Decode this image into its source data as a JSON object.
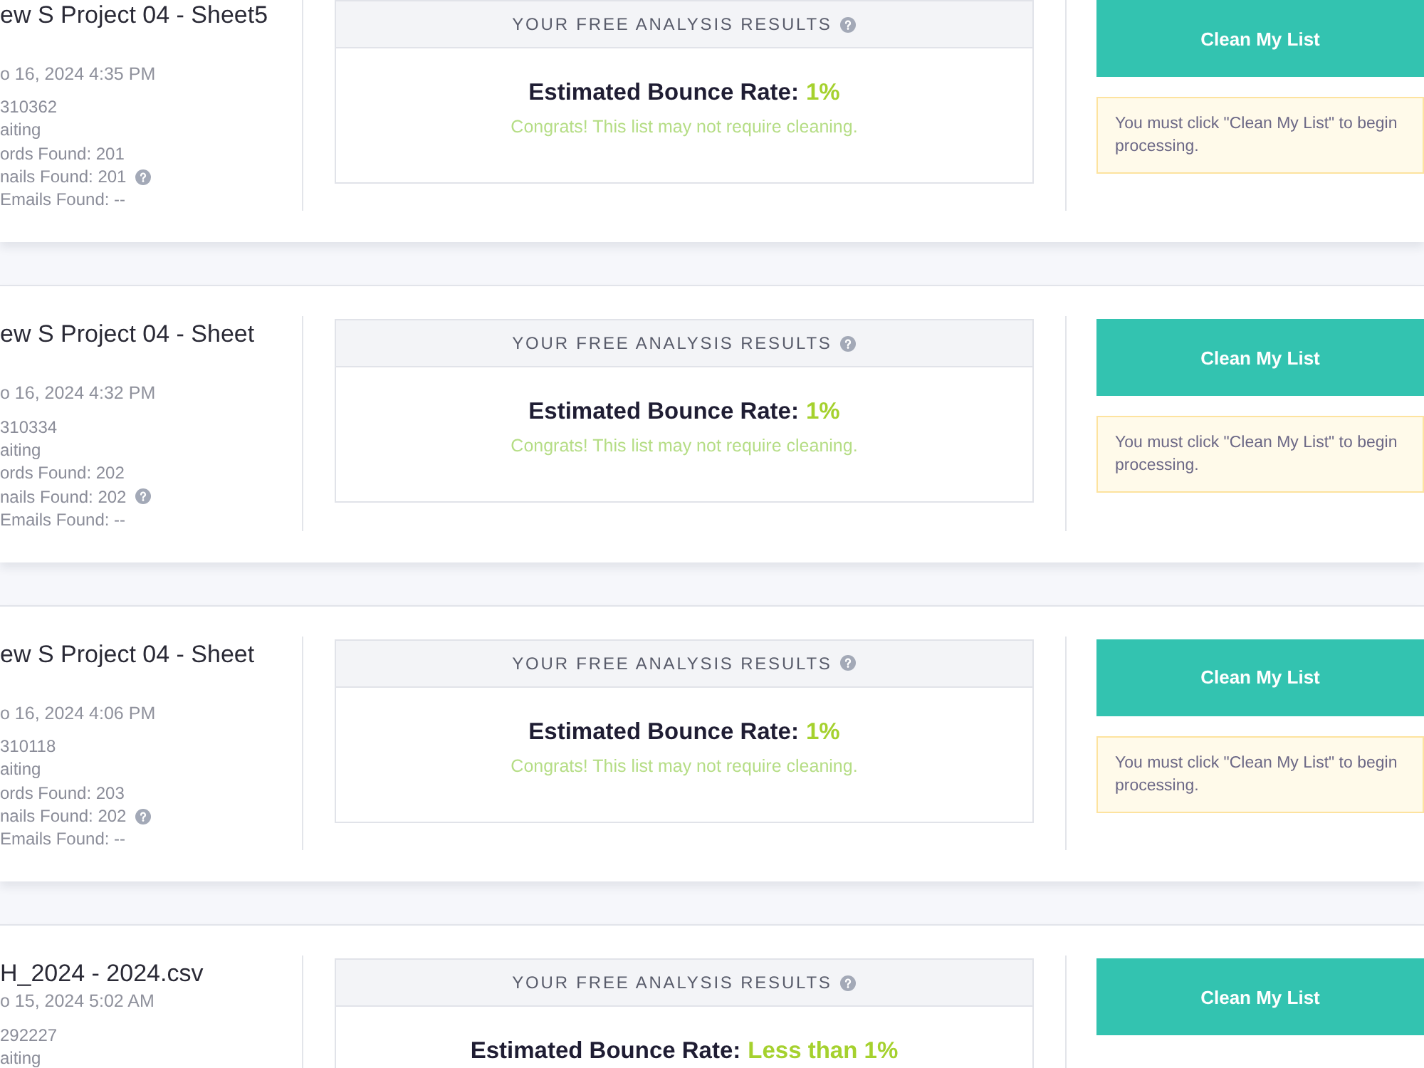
{
  "jobs": [
    {
      "title": "ew S Project 04 - Sheet5",
      "title_wraps": true,
      "date": "o 16, 2024 4:35 PM",
      "details": [
        {
          "text": "310362",
          "help": false
        },
        {
          "text": "aiting",
          "help": false
        },
        {
          "text": "ords Found: 201",
          "help": false
        },
        {
          "text": "nails Found: 201",
          "help": true
        },
        {
          "text": "Emails Found: --",
          "help": false
        }
      ],
      "analysis": {
        "heading": "YOUR FREE ANALYSIS RESULTS",
        "rate_label": "Estimated Bounce Rate:",
        "rate_value": "1%",
        "message": "Congrats! This list may not require cleaning."
      },
      "button": "Clean My List",
      "notice": "You must click \"Clean My List\" to begin processing."
    },
    {
      "title": "ew S Project 04 - Sheet",
      "title_wraps": true,
      "date": "o 16, 2024 4:32 PM",
      "details": [
        {
          "text": "310334",
          "help": false
        },
        {
          "text": "aiting",
          "help": false
        },
        {
          "text": "ords Found: 202",
          "help": false
        },
        {
          "text": "nails Found: 202",
          "help": true
        },
        {
          "text": "Emails Found: --",
          "help": false
        }
      ],
      "analysis": {
        "heading": "YOUR FREE ANALYSIS RESULTS",
        "rate_label": "Estimated Bounce Rate:",
        "rate_value": "1%",
        "message": "Congrats! This list may not require cleaning."
      },
      "button": "Clean My List",
      "notice": "You must click \"Clean My List\" to begin processing."
    },
    {
      "title": "ew S Project 04 - Sheet",
      "title_wraps": true,
      "date": "o 16, 2024 4:06 PM",
      "details": [
        {
          "text": "310118",
          "help": false
        },
        {
          "text": "aiting",
          "help": false
        },
        {
          "text": "ords Found: 203",
          "help": false
        },
        {
          "text": "nails Found: 202",
          "help": true
        },
        {
          "text": "Emails Found: --",
          "help": false
        }
      ],
      "analysis": {
        "heading": "YOUR FREE ANALYSIS RESULTS",
        "rate_label": "Estimated Bounce Rate:",
        "rate_value": "1%",
        "message": "Congrats! This list may not require cleaning."
      },
      "button": "Clean My List",
      "notice": "You must click \"Clean My List\" to begin processing."
    },
    {
      "title": "H_2024 - 2024.csv",
      "title_wraps": false,
      "date": "o 15, 2024 5:02 AM",
      "details": [
        {
          "text": "292227",
          "help": false
        },
        {
          "text": "aiting",
          "help": false
        }
      ],
      "analysis": {
        "heading": "YOUR FREE ANALYSIS RESULTS",
        "rate_label": "Estimated Bounce Rate:",
        "rate_value": "Less than 1%"
      },
      "button": "Clean My List"
    }
  ]
}
